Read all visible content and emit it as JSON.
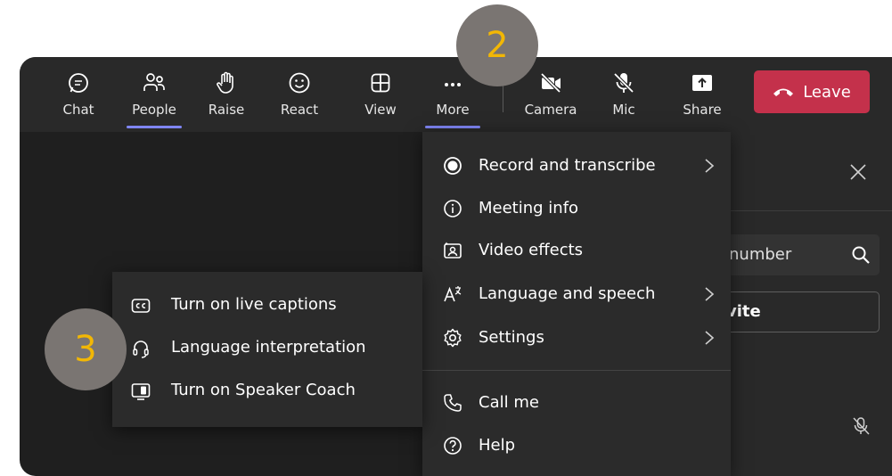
{
  "toolbar": {
    "chat": {
      "label": "Chat",
      "icon": "chat-icon"
    },
    "people": {
      "label": "People",
      "icon": "people-icon"
    },
    "raise": {
      "label": "Raise",
      "icon": "raise-hand-icon"
    },
    "react": {
      "label": "React",
      "icon": "smiley-icon"
    },
    "view": {
      "label": "View",
      "icon": "grid-icon"
    },
    "more": {
      "label": "More",
      "icon": "ellipsis-icon"
    },
    "camera": {
      "label": "Camera",
      "icon": "camera-off-icon"
    },
    "mic": {
      "label": "Mic",
      "icon": "mic-off-icon"
    },
    "share": {
      "label": "Share",
      "icon": "share-icon"
    },
    "leave": {
      "label": "Leave",
      "icon": "hang-up-icon"
    },
    "accent_color": "#7f85f5",
    "leave_color": "#c4314b"
  },
  "more_menu": {
    "items": [
      {
        "label": "Record and transcribe",
        "icon": "record-icon",
        "has_submenu": true
      },
      {
        "label": "Meeting info",
        "icon": "info-icon",
        "has_submenu": false
      },
      {
        "label": "Video effects",
        "icon": "video-effects-icon",
        "has_submenu": false
      },
      {
        "label": "Language and speech",
        "icon": "language-icon",
        "has_submenu": true
      },
      {
        "label": "Settings",
        "icon": "gear-icon",
        "has_submenu": true
      },
      {
        "label": "Call me",
        "icon": "phone-icon",
        "has_submenu": false
      },
      {
        "label": "Help",
        "icon": "help-icon",
        "has_submenu": false
      }
    ]
  },
  "language_submenu": {
    "items": [
      {
        "label": "Turn on live captions",
        "icon": "captions-icon"
      },
      {
        "label": "Language interpretation",
        "icon": "headset-icon"
      },
      {
        "label": "Turn on Speaker Coach",
        "icon": "speaker-coach-icon"
      }
    ]
  },
  "people_panel": {
    "search_text": "number",
    "invite_text": "vite"
  },
  "callouts": {
    "step2": "2",
    "step3": "3",
    "color": "#f2b705"
  }
}
